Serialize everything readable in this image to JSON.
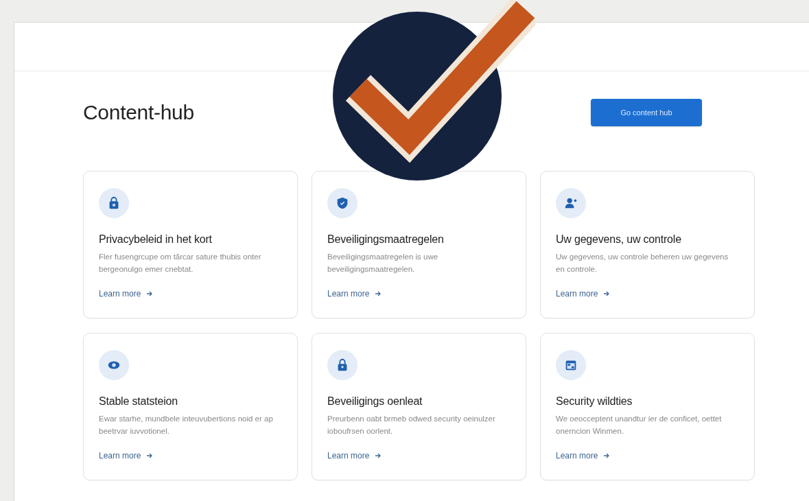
{
  "header": {
    "title": "Content-hub",
    "button": "Go content hub"
  },
  "cards": [
    {
      "title": "Privacybeleid in het kort",
      "description": "Fler fusengrcupe om tãrcar sature thubis onter bergeonulgo emer cnebtat.",
      "link": "Learn more"
    },
    {
      "title": "Beveiligingsmaatregelen",
      "description": "Beveiligingsmaatregelen is uwe beveiligingsmaatregelen.",
      "link": "Learn more"
    },
    {
      "title": "Uw gegevens, uw controle",
      "description": "Uw gegevens, uw controle beheren uw gegevens en controle.",
      "link": "Learn more"
    },
    {
      "title": "Stable statsteion",
      "description": "Ewar starhe, mundbele inteuvubertions noid er ap beetrvar iuvvotionel.",
      "link": "Learn more"
    },
    {
      "title": "Beveiligings oenleat",
      "description": "Preurbenn oabt brmeb odwed security oeinulzer ioboufrsen oorlent.",
      "link": "Learn more"
    },
    {
      "title": "Security wildties",
      "description": "We oeocceptent unandtur ier de conficet, oettet onerncion Winmen.",
      "link": "Learn more"
    }
  ]
}
